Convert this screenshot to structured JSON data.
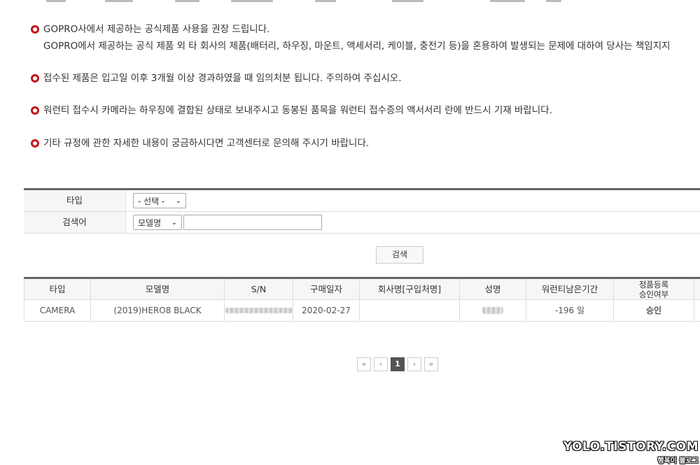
{
  "notices": [
    {
      "line1": "GOPRO사에서 제공하는 공식제품 사용을 권장 드립니다.",
      "line2": "GOPRO에서 제공하는 공식 제품 외 타 회사의 제품(배터리, 하우징, 마운트, 액세서리, 케이블, 충전기 등)을 혼용하여 발생되는 문제에 대하여 당사는 책임지지"
    },
    {
      "line1": "접수된 제품은 입고일 이후 3개월 이상 경과하였을 때 임의처분 됩니다. 주의하여 주십시오."
    },
    {
      "line1": "워런티 접수시 카메라는 하우징에 결합된 상태로 보내주시고 동봉된 품목을 워런티 접수증의 액서서리 란에 반드시 기재 바랍니다."
    },
    {
      "line1": "기타 규정에 관한 자세한 내용이 궁금하시다면 고객센터로 문의해 주시기 바랍니다."
    }
  ],
  "search": {
    "type_label": "타입",
    "type_value": "- 선택 -",
    "keyword_label": "검색어",
    "field_value": "모델명",
    "keyword_value": "",
    "button_label": "검색"
  },
  "table": {
    "headers": [
      "타입",
      "모델명",
      "S/N",
      "구매일자",
      "회사명[구입처명]",
      "성명",
      "워런티남은기간",
      "정품등록\n승인여부"
    ],
    "rows": [
      {
        "type": "CAMERA",
        "model": "(2019)HERO8 BLACK",
        "sn": "",
        "purchase_date": "2020-02-27",
        "company": "",
        "name": "",
        "warranty_left": "-196 일",
        "approval": "승인"
      }
    ]
  },
  "pagination": {
    "first": "«",
    "prev": "‹",
    "current": "1",
    "next": "›",
    "last": "»"
  },
  "watermark": {
    "main": "YOLO.TISTORY.COM",
    "sub": "행복이 블로그"
  },
  "colors": {
    "bullet": "#c4161c",
    "approved": "#2e9a2e",
    "active_page": "#555555"
  }
}
